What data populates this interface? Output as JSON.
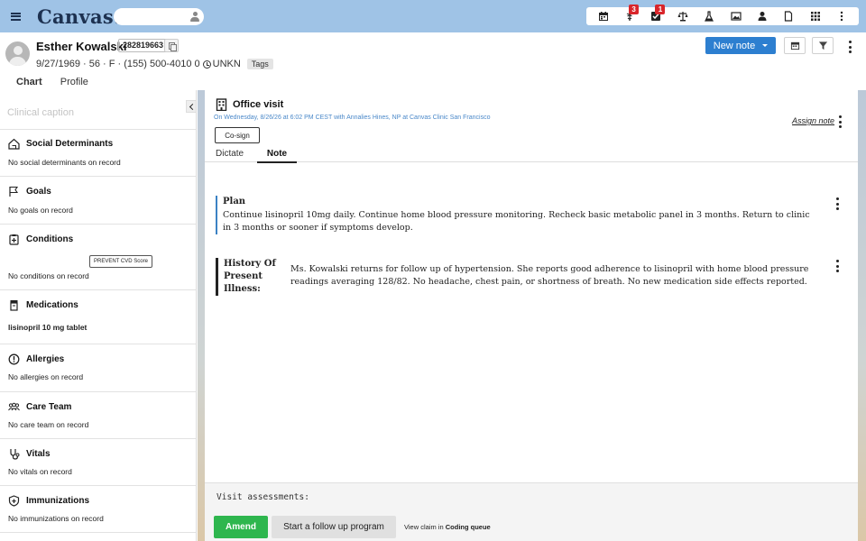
{
  "app": {
    "logo": "Canvas:"
  },
  "toolbar": {
    "badges": {
      "tasks": "3",
      "inbox": "1"
    },
    "icons": [
      "calendar-icon",
      "caduceus-icon",
      "checkbox-icon",
      "scale-icon",
      "flask-icon",
      "image-icon",
      "person-icon",
      "document-icon",
      "grid-icon",
      "more-icon"
    ]
  },
  "patient": {
    "name": "Esther Kowalski",
    "mrn": "282819663",
    "demographics": "9/27/1969 · 56 · F · (155) 500-4010 0",
    "timezone": "UNKN",
    "tags": "Tags",
    "tabs": [
      "Chart",
      "Profile"
    ]
  },
  "header_actions": {
    "new_note": "New note"
  },
  "sidebar": {
    "caption_placeholder": "Clinical caption",
    "sections": [
      {
        "title": "Social Determinants",
        "body": "No social determinants on record"
      },
      {
        "title": "Goals",
        "body": "No goals on record"
      },
      {
        "title": "Conditions",
        "body": "No conditions on record",
        "button": "PREVENT CVD Score"
      },
      {
        "title": "Medications",
        "body": "lisinopril 10 mg tablet"
      },
      {
        "title": "Allergies",
        "body": "No allergies on record"
      },
      {
        "title": "Care Team",
        "body": "No care team on record"
      },
      {
        "title": "Vitals",
        "body": "No vitals on record"
      },
      {
        "title": "Immunizations",
        "body": "No immunizations on record"
      }
    ]
  },
  "note": {
    "title": "Office visit",
    "subtitle": "On Wednesday, 8/26/26 at 6:02 PM CEST with Annalies Hines, NP at Canvas Clinic San Francisco",
    "assign": "Assign note",
    "cosign": "Co-sign",
    "tabs": {
      "dictate": "Dictate",
      "note": "Note"
    },
    "plan": {
      "label": "Plan",
      "text": "Continue lisinopril 10mg daily. Continue home blood pressure monitoring. Recheck basic metabolic panel in 3 months. Return to clinic in 3 months or sooner if symptoms develop."
    },
    "hpi": {
      "label": "History Of Present Illness:",
      "text": "Ms. Kowalski returns for follow up of hypertension. She reports good adherence to lisinopril with home blood pressure readings averaging 128/82. No headache, chest pain, or shortness of breath. No new medication side effects reported."
    },
    "footer": {
      "assessments": "Visit assessments:",
      "amend": "Amend",
      "followup": "Start a follow up program",
      "view_claim_prefix": "View claim in",
      "view_claim_link": "Coding queue"
    }
  }
}
